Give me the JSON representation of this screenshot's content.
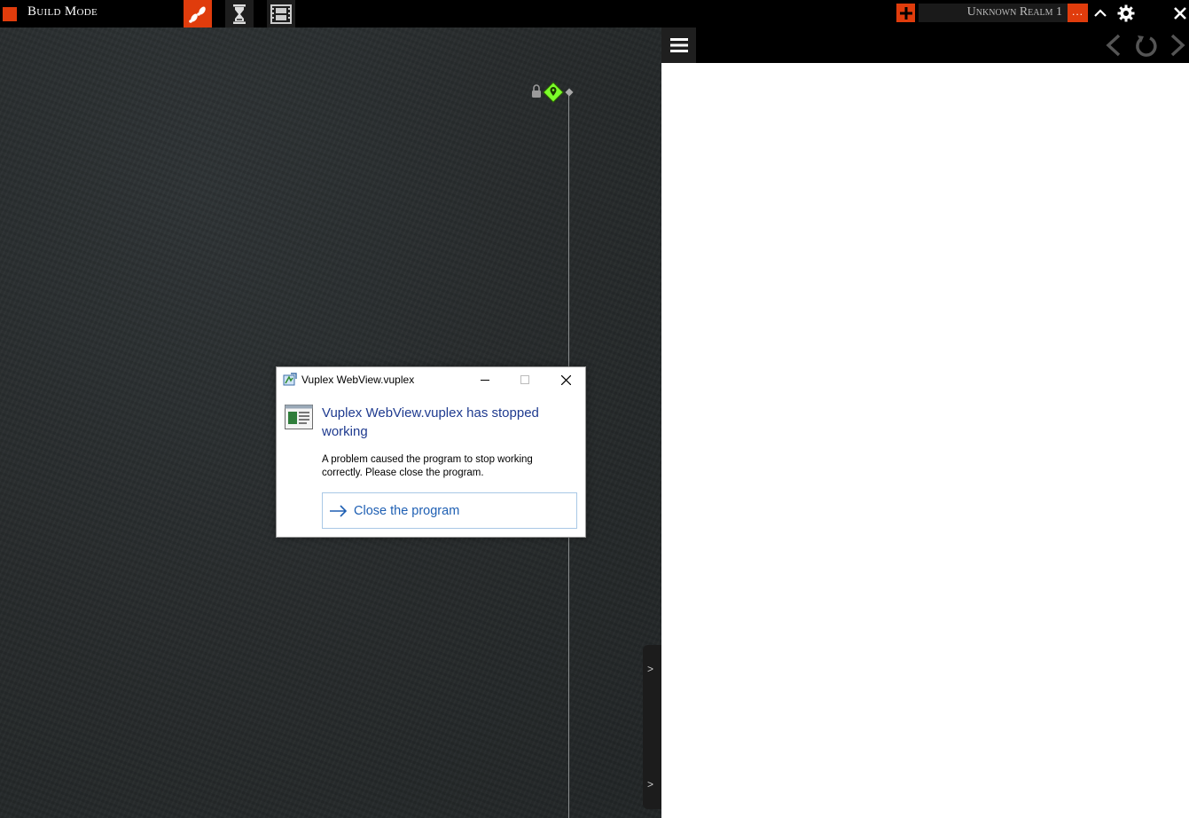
{
  "topbar": {
    "title": "Build Mode",
    "tools": [
      {
        "name": "footprints-tool",
        "icon": "footsteps-icon"
      },
      {
        "name": "hourglass-tool",
        "icon": "hourglass-icon"
      },
      {
        "name": "film-tool",
        "icon": "film-strip-icon"
      }
    ],
    "realm_name": "Unknown Realm 1",
    "realm_more": "...",
    "accent_color": "#e03c0c"
  },
  "game_view": {
    "side_arrows": [
      ">",
      ">"
    ]
  },
  "browser": {
    "nav": [
      "back-icon",
      "reload-icon",
      "forward-icon"
    ]
  },
  "dialog": {
    "window_title": "Vuplex WebView.vuplex",
    "heading": "Vuplex WebView.vuplex has stopped working",
    "body": "A problem caused the program to stop working correctly. Please close the program.",
    "action_label": "Close the program"
  }
}
